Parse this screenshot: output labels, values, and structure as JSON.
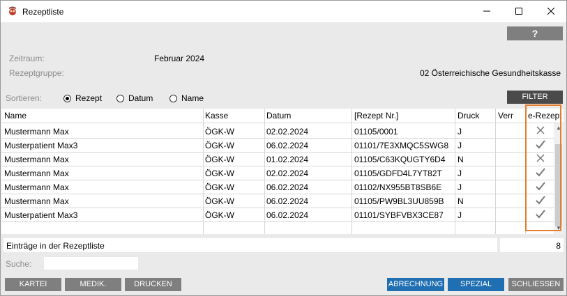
{
  "window": {
    "title": "Rezeptliste",
    "minimize": "—",
    "maximize": "☐",
    "close": "✕"
  },
  "help": {
    "label": "?"
  },
  "info": {
    "zeitraum_label": "Zeitraum:",
    "zeitraum_value": "Februar 2024",
    "gruppe_label": "Rezeptgruppe:",
    "gruppe_value": "02 Österreichische Gesundheitskasse"
  },
  "sort": {
    "label": "Sortieren:",
    "options": [
      "Rezept",
      "Datum",
      "Name"
    ],
    "selected": "Rezept"
  },
  "filter": {
    "label": "FILTER"
  },
  "table": {
    "headers": [
      "Name",
      "Kasse",
      "Datum",
      "[Rezept Nr.]",
      "Druck",
      "Verr",
      "e-Rezept"
    ],
    "rows": [
      {
        "name": "Mustermann Max",
        "kasse": "ÖGK-W",
        "datum": "02.02.2024",
        "rezept": "01105/0001",
        "druck": "J",
        "verr": "",
        "erezept": "x-icon"
      },
      {
        "name": "Musterpatient Max3",
        "kasse": "ÖGK-W",
        "datum": "06.02.2024",
        "rezept": "01101/7E3XMQC5SWG8",
        "druck": "J",
        "verr": "",
        "erezept": "check-icon"
      },
      {
        "name": "Mustermann Max",
        "kasse": "ÖGK-W",
        "datum": "01.02.2024",
        "rezept": "01105/C63KQUGTY6D4",
        "druck": "N",
        "verr": "",
        "erezept": "x-icon"
      },
      {
        "name": "Mustermann Max",
        "kasse": "ÖGK-W",
        "datum": "02.02.2024",
        "rezept": "01105/GDFD4L7YT82T",
        "druck": "J",
        "verr": "",
        "erezept": "check-icon"
      },
      {
        "name": "Mustermann Max",
        "kasse": "ÖGK-W",
        "datum": "06.02.2024",
        "rezept": "01102/NX955BT8SB6E",
        "druck": "J",
        "verr": "",
        "erezept": "check-icon"
      },
      {
        "name": "Mustermann Max",
        "kasse": "ÖGK-W",
        "datum": "06.02.2024",
        "rezept": "01105/PW9BL3UU859B",
        "druck": "N",
        "verr": "",
        "erezept": "check-icon"
      },
      {
        "name": "Musterpatient Max3",
        "kasse": "ÖGK-W",
        "datum": "06.02.2024",
        "rezept": "01101/SYBFVBX3CE87",
        "druck": "J",
        "verr": "",
        "erezept": "check-icon"
      }
    ]
  },
  "status": {
    "label": "Einträge in der Rezeptliste",
    "count": "8"
  },
  "search": {
    "label": "Suche:",
    "value": "",
    "placeholder": ""
  },
  "buttons": {
    "kartei": "KARTEI",
    "medik": "MEDIK.",
    "drucken": "DRUCKEN",
    "abrechnung": "ABRECHNUNG",
    "spezial": "SPEZIAL",
    "schliessen": "SCHLIESSEN"
  },
  "colors": {
    "accent_blue": "#1f6fb2",
    "grey_button": "#7f7f7f",
    "highlight": "#e47e2b"
  }
}
